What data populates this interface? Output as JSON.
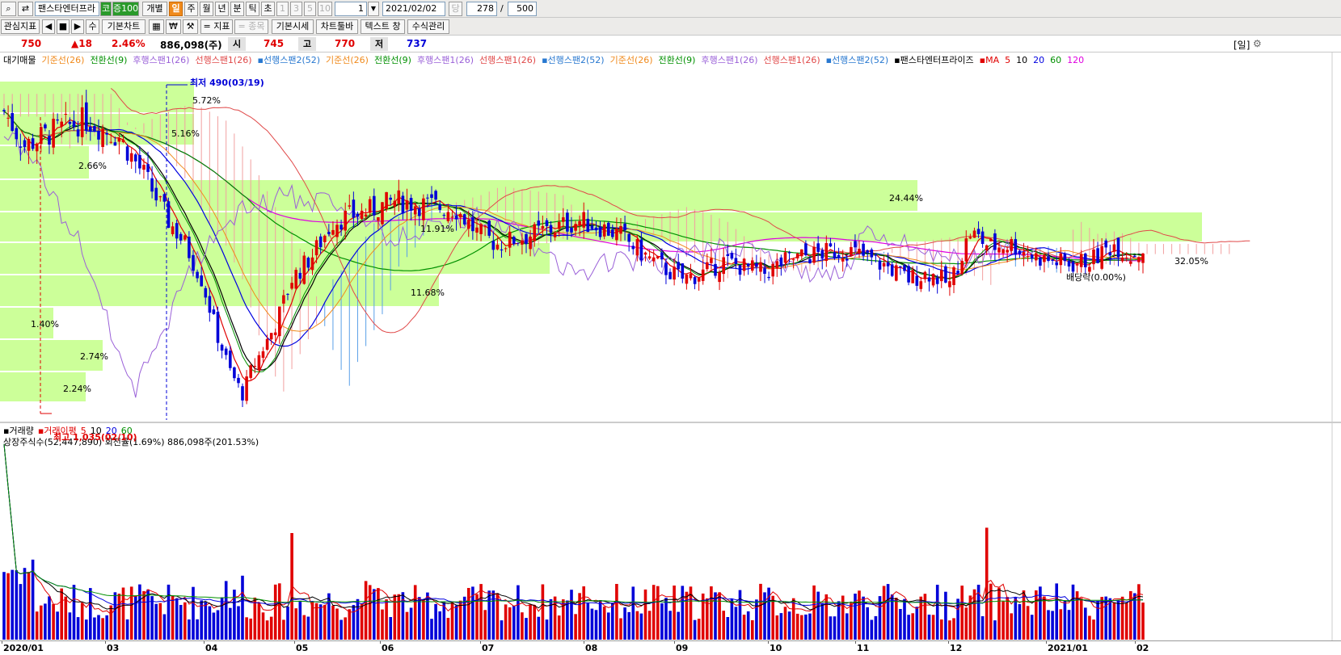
{
  "toolbar1": {
    "stock_name": "팬스타엔터프라",
    "badge1": "코",
    "badge2": "증100",
    "individual_label": "개별",
    "period_tabs": [
      "일",
      "주",
      "월",
      "년",
      "분",
      "틱",
      "초"
    ],
    "active_period": "일",
    "interval_options": [
      "1",
      "3",
      "5",
      "10"
    ],
    "interval_value": "1",
    "date_value": "2021/02/02",
    "date_suffix": "당",
    "count_value": "278",
    "slash": "/",
    "max_value": "500"
  },
  "toolbar2": {
    "watch_label": "관심지표",
    "nav_buttons": [
      "◀",
      "■",
      "▶"
    ],
    "su_label": "수",
    "basic_chart_label": "기본차트",
    "krw_label": "₩",
    "indicator_label": "= 지표",
    "stock_label": "= 종목",
    "basic_quote_label": "기본시세",
    "chart_toolbar_label": "차트툴바",
    "text_window_label": "텍스트 창",
    "formula_label": "수식관리"
  },
  "pricebar": {
    "price": "750",
    "change": "▲18",
    "change_pct": "2.46%",
    "volume": "886,098(주)",
    "open_label": "시",
    "open": "745",
    "high_label": "고",
    "high": "770",
    "low_label": "저",
    "low": "737",
    "period_tag": "[일]"
  },
  "legend_items": [
    {
      "text": "대기매물",
      "color": "#000000"
    },
    {
      "text": "기준선(26)",
      "color": "#f08a1c"
    },
    {
      "text": "전환선(9)",
      "color": "#009000"
    },
    {
      "text": "후행스팬1(26)",
      "color": "#9a60d8"
    },
    {
      "text": "선행스팬1(26)",
      "color": "#e04848"
    },
    {
      "text": "▪선행스팬2(52)",
      "color": "#2878d0"
    },
    {
      "text": "기준선(26)",
      "color": "#f08a1c"
    },
    {
      "text": "전환선(9)",
      "color": "#009000"
    },
    {
      "text": "후행스팬1(26)",
      "color": "#9a60d8"
    },
    {
      "text": "선행스팬1(26)",
      "color": "#e04848"
    },
    {
      "text": "▪선행스팬2(52)",
      "color": "#2878d0"
    },
    {
      "text": "기준선(26)",
      "color": "#f08a1c"
    },
    {
      "text": "전환선(9)",
      "color": "#009000"
    },
    {
      "text": "후행스팬1(26)",
      "color": "#9a60d8"
    },
    {
      "text": "선행스팬1(26)",
      "color": "#e04848"
    },
    {
      "text": "▪선행스팬2(52)",
      "color": "#2878d0"
    },
    {
      "text": "▪팬스타엔터프라이즈",
      "color": "#000000"
    },
    {
      "text": "▪MA",
      "color": "#e00000"
    },
    {
      "text": "5",
      "color": "#e00000"
    },
    {
      "text": "10",
      "color": "#000000"
    },
    {
      "text": "20",
      "color": "#0000e0"
    },
    {
      "text": "60",
      "color": "#009000"
    },
    {
      "text": "120",
      "color": "#e000e0"
    }
  ],
  "volume_legend": [
    {
      "text": "▪거래량",
      "color": "#000000"
    },
    {
      "text": "▪거래이평",
      "color": "#e00000"
    },
    {
      "text": "5",
      "color": "#e00000"
    },
    {
      "text": "10",
      "color": "#000000"
    },
    {
      "text": "20",
      "color": "#0000e0"
    },
    {
      "text": "60",
      "color": "#009000"
    }
  ],
  "volume_info": "상장주식수(52,447,890) 회전율(1.69%) 886,098주(201.53%)",
  "annotations": {
    "low_marker": "최저 490(03/19)",
    "high_marker": "최고 1,035(02/10)",
    "dividend": "배당락(0.00%)"
  },
  "x_ticks": [
    "2020/01",
    "03",
    "04",
    "05",
    "06",
    "07",
    "08",
    "09",
    "10",
    "11",
    "12",
    "2021/01",
    "02"
  ],
  "chart_data": {
    "type": "candlestick",
    "price_range": [
      460,
      1080
    ],
    "volume_profile_pct": [
      "5.72%",
      "5.16%",
      "2.66%",
      "24.44%",
      "11.91%",
      "11.68%",
      "1.40%",
      "2.74%",
      "2.24%",
      "32.05%"
    ],
    "price_panel_series": [
      "candles",
      "MA5",
      "MA10",
      "MA20",
      "MA60",
      "MA120",
      "일목균형표 기준선",
      "전환선",
      "후행스팬",
      "선행스팬1",
      "선행스팬2",
      "대기매물"
    ],
    "volume_panel_series": [
      "거래량",
      "거래이평 5",
      "10",
      "20",
      "60"
    ],
    "colors": {
      "up": "#e00000",
      "down": "#0000d8",
      "profile": "#ccff99"
    }
  }
}
